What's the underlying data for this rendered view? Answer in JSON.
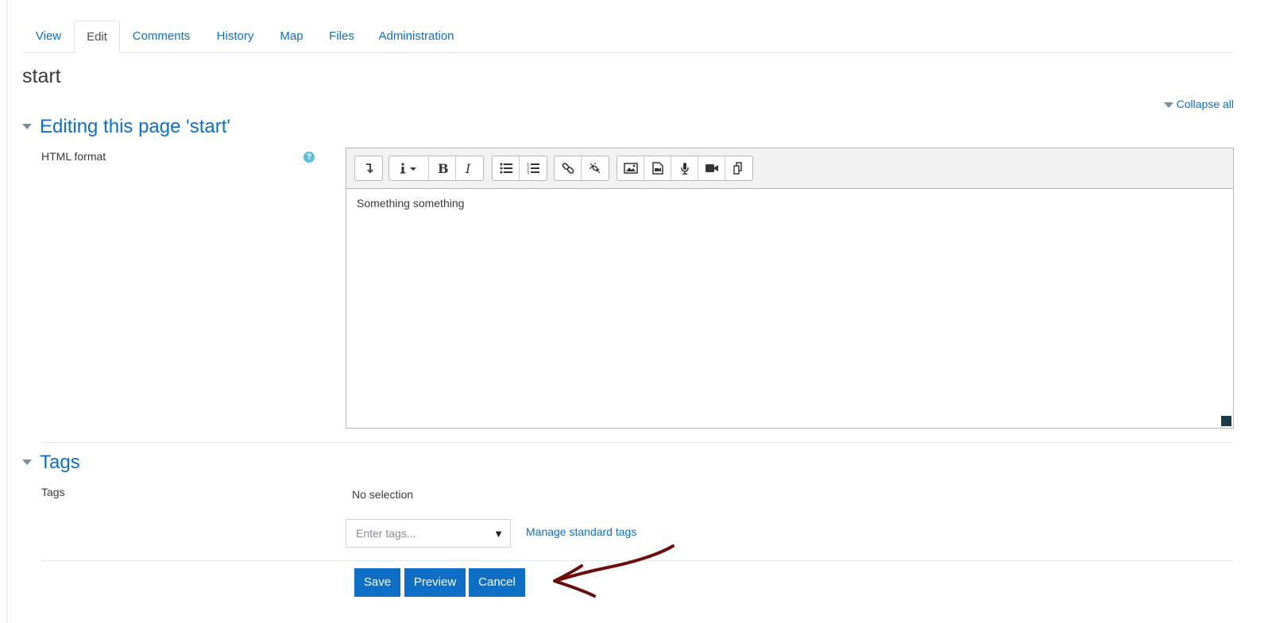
{
  "tabs": [
    {
      "label": "View"
    },
    {
      "label": "Edit",
      "active": true
    },
    {
      "label": "Comments"
    },
    {
      "label": "History"
    },
    {
      "label": "Map"
    },
    {
      "label": "Files"
    },
    {
      "label": "Administration"
    }
  ],
  "page": {
    "title": "start",
    "collapse_all": "Collapse all"
  },
  "editing_section": {
    "header": "Editing this page 'start'",
    "field_label": "HTML format",
    "help_icon": "?",
    "content": "Something something"
  },
  "toolbar": {
    "groups": [
      [
        "collapse-toolbar-icon"
      ],
      [
        "info-style-dropdown-icon",
        "bold-icon",
        "italic-icon"
      ],
      [
        "unordered-list-icon",
        "ordered-list-icon"
      ],
      [
        "link-icon",
        "unlink-icon"
      ],
      [
        "image-icon",
        "media-icon",
        "record-audio-icon",
        "record-video-icon",
        "manage-files-icon"
      ]
    ]
  },
  "tags_section": {
    "header": "Tags",
    "field_label": "Tags",
    "selection": "No selection",
    "input_placeholder": "Enter tags...",
    "dropdown_arrow": "▼",
    "manage_link": "Manage standard tags"
  },
  "actions": {
    "save": "Save",
    "preview": "Preview",
    "cancel": "Cancel"
  },
  "colors": {
    "link": "#0f6fc5",
    "primary_button": "#0f6fc5",
    "annotation_arrow": "#6b0d0d"
  }
}
